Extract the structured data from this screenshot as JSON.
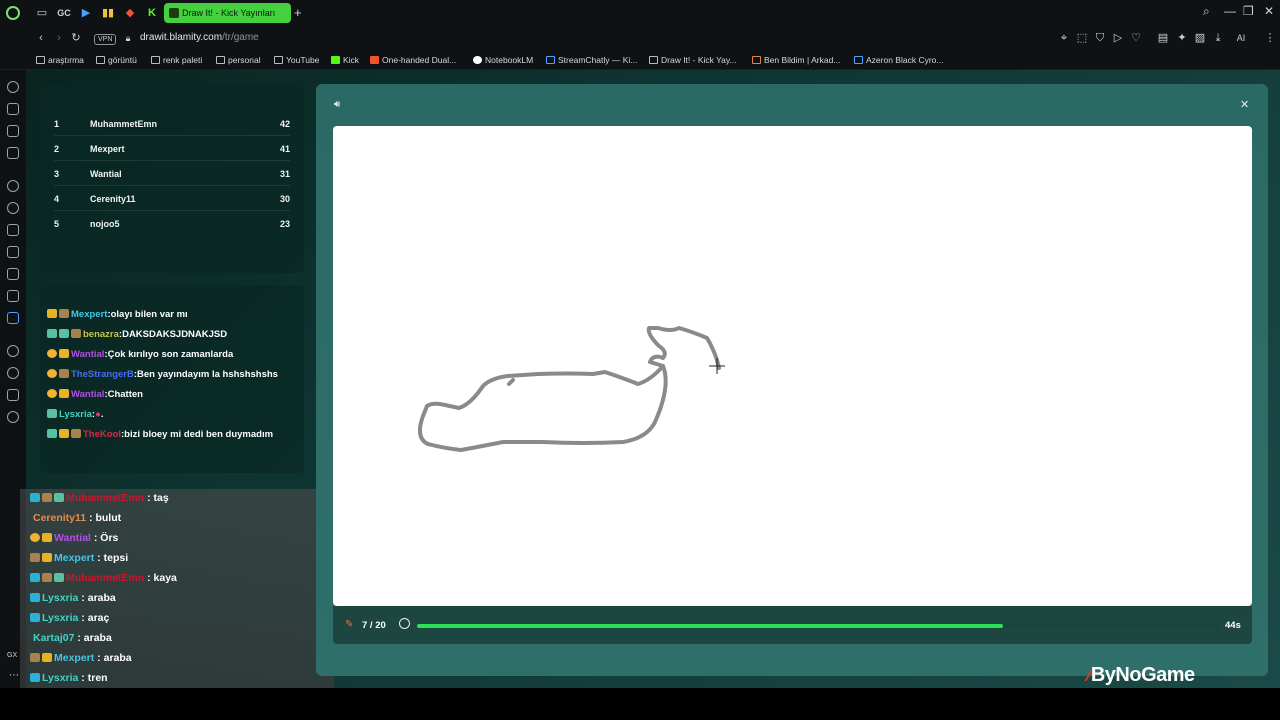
{
  "browser": {
    "active_tab": "Draw It! - Kick Yayınları",
    "pinned_tabs": [
      "GC"
    ],
    "url_host": "drawit.blamity.com",
    "url_path": "/tr/game",
    "vpn_label": "VPN",
    "ai_label": "AI"
  },
  "bookmarks": [
    "araştırma",
    "görüntü",
    "renk paleti",
    "personal",
    "YouTube",
    "Kick",
    "One-handed Dual...",
    "NotebookLM",
    "StreamChatly — Ki...",
    "Draw It! - Kick Yay...",
    "Ben Bildim | Arkad...",
    "Azeron Black Cyro..."
  ],
  "sidebar_label": "GX",
  "leaderboard": [
    {
      "rank": "1",
      "name": "MuhammetEmn",
      "score": "42"
    },
    {
      "rank": "2",
      "name": "Mexpert",
      "score": "41"
    },
    {
      "rank": "3",
      "name": "Wantial",
      "score": "31"
    },
    {
      "rank": "4",
      "name": "Cerenity11",
      "score": "30"
    },
    {
      "rank": "5",
      "name": "nojoo5",
      "score": "23"
    }
  ],
  "chat": [
    {
      "user": "Mexpert",
      "text": "olayı bilen var mı",
      "color": "#42c7e8"
    },
    {
      "user": "benazra",
      "text": "DAKSDAKSJDNAKJSD",
      "color": "#c9c24a"
    },
    {
      "user": "Wantial",
      "text": "Çok kırılıyo son zamanlarda",
      "color": "#b24ee6"
    },
    {
      "user": "TheStrangerB",
      "text": "Ben yayındayım la hshshshshs",
      "color": "#4a6cf0"
    },
    {
      "user": "Wantial",
      "text": "Chatten",
      "color": "#b24ee6"
    },
    {
      "user": "Lysxria",
      "text": "",
      "color": "#3fd4c3"
    },
    {
      "user": "TheKool",
      "text": "bizi bloey mi dedi ben duymadım",
      "color": "#d8274b"
    }
  ],
  "overlay_chat": [
    {
      "user": "MuhammetEmn",
      "text": "taş",
      "color": "#c8162e"
    },
    {
      "user": "Cerenity11",
      "text": "bulut",
      "color": "#e58b4e"
    },
    {
      "user": "Wantial",
      "text": "Örs",
      "color": "#b24ee6"
    },
    {
      "user": "Mexpert",
      "text": "tepsi",
      "color": "#42c7e8"
    },
    {
      "user": "MuhammetEmn",
      "text": "kaya",
      "color": "#c8162e"
    },
    {
      "user": "Lysxria",
      "text": "araba",
      "color": "#3fd4c3"
    },
    {
      "user": "Lysxria",
      "text": "araç",
      "color": "#3fd4c3"
    },
    {
      "user": "Kartaj07",
      "text": "araba",
      "color": "#3fd4c3"
    },
    {
      "user": "Mexpert",
      "text": "araba",
      "color": "#42c7e8"
    },
    {
      "user": "Lysxria",
      "text": "tren",
      "color": "#3fd4c3"
    }
  ],
  "game": {
    "round": "7 / 20",
    "timer": "44s",
    "progress": 0.73,
    "progress_color": "#2de05a"
  },
  "watermark": "ByNoGame"
}
